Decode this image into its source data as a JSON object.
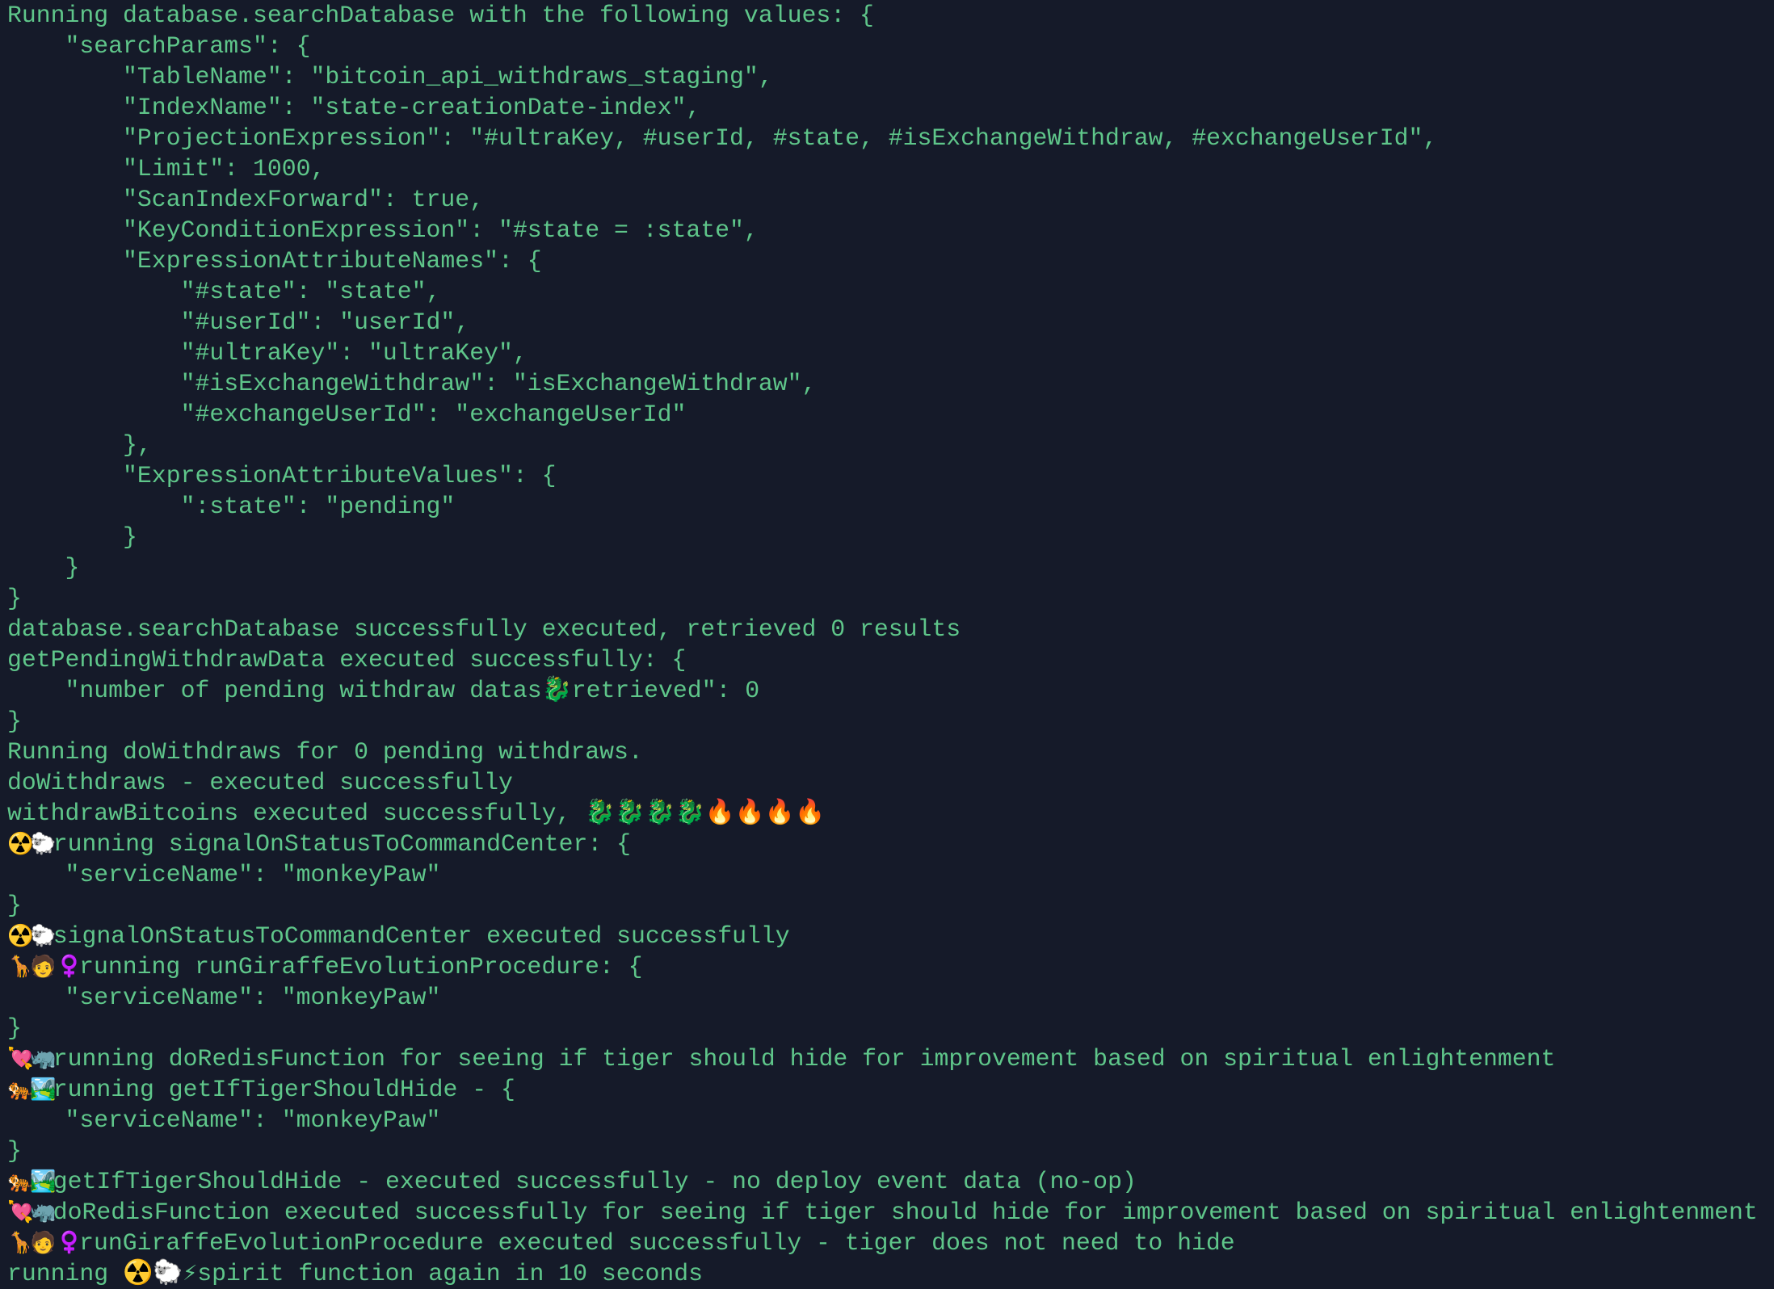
{
  "terminal": {
    "text_color": "#5fc68a",
    "background_color": "#151a29",
    "lines": [
      {
        "emoji": "",
        "text": "Running database.searchDatabase with the following values: {"
      },
      {
        "emoji": "",
        "text": "    \"searchParams\": {"
      },
      {
        "emoji": "",
        "text": "        \"TableName\": \"bitcoin_api_withdraws_staging\","
      },
      {
        "emoji": "",
        "text": "        \"IndexName\": \"state-creationDate-index\","
      },
      {
        "emoji": "",
        "text": "        \"ProjectionExpression\": \"#ultraKey, #userId, #state, #isExchangeWithdraw, #exchangeUserId\","
      },
      {
        "emoji": "",
        "text": "        \"Limit\": 1000,"
      },
      {
        "emoji": "",
        "text": "        \"ScanIndexForward\": true,"
      },
      {
        "emoji": "",
        "text": "        \"KeyConditionExpression\": \"#state = :state\","
      },
      {
        "emoji": "",
        "text": "        \"ExpressionAttributeNames\": {"
      },
      {
        "emoji": "",
        "text": "            \"#state\": \"state\","
      },
      {
        "emoji": "",
        "text": "            \"#userId\": \"userId\","
      },
      {
        "emoji": "",
        "text": "            \"#ultraKey\": \"ultraKey\","
      },
      {
        "emoji": "",
        "text": "            \"#isExchangeWithdraw\": \"isExchangeWithdraw\","
      },
      {
        "emoji": "",
        "text": "            \"#exchangeUserId\": \"exchangeUserId\""
      },
      {
        "emoji": "",
        "text": "        },"
      },
      {
        "emoji": "",
        "text": "        \"ExpressionAttributeValues\": {"
      },
      {
        "emoji": "",
        "text": "            \":state\": \"pending\""
      },
      {
        "emoji": "",
        "text": "        }"
      },
      {
        "emoji": "",
        "text": "    }"
      },
      {
        "emoji": "",
        "text": "}"
      },
      {
        "emoji": "",
        "text": "database.searchDatabase successfully executed, retrieved 0 results"
      },
      {
        "emoji": "",
        "text": "getPendingWithdrawData executed successfully: {"
      },
      {
        "emoji": "",
        "text": "    \"number of pending withdraw datas🐉retrieved\": 0"
      },
      {
        "emoji": "",
        "text": "}"
      },
      {
        "emoji": "",
        "text": "Running doWithdraws for 0 pending withdraws."
      },
      {
        "emoji": "",
        "text": "doWithdraws - executed successfully"
      },
      {
        "emoji": "",
        "text": "withdrawBitcoins executed successfully, 🐉🐉🐉🐉🔥🔥🔥🔥"
      },
      {
        "emoji": "☢️🐑",
        "text": "running signalOnStatusToCommandCenter: {"
      },
      {
        "emoji": "",
        "text": "    \"serviceName\": \"monkeyPaw\""
      },
      {
        "emoji": "",
        "text": "}"
      },
      {
        "emoji": "☢️🐑",
        "text": "signalOnStatusToCommandCenter executed successfully"
      },
      {
        "emoji": "🦒🧑‍♀",
        "text": "running runGiraffeEvolutionProcedure: {"
      },
      {
        "emoji": "",
        "text": "    \"serviceName\": \"monkeyPaw\""
      },
      {
        "emoji": "",
        "text": "}"
      },
      {
        "emoji": "💘🦏",
        "text": "running doRedisFunction for seeing if tiger should hide for improvement based on spiritual enlightenment"
      },
      {
        "emoji": "🐅🏞️",
        "text": "running getIfTigerShouldHide - {"
      },
      {
        "emoji": "",
        "text": "    \"serviceName\": \"monkeyPaw\""
      },
      {
        "emoji": "",
        "text": "}"
      },
      {
        "emoji": "🐅🏞️",
        "text": "getIfTigerShouldHide - executed successfully - no deploy event data (no-op)"
      },
      {
        "emoji": "💘🦏",
        "text": "doRedisFunction executed successfully for seeing if tiger should hide for improvement based on spiritual enlightenment"
      },
      {
        "emoji": "🦒🧑‍♀",
        "text": "runGiraffeEvolutionProcedure executed successfully - tiger does not need to hide"
      },
      {
        "emoji": "",
        "text": "running ☢️🐑⚡spirit function again in 10 seconds"
      }
    ]
  }
}
